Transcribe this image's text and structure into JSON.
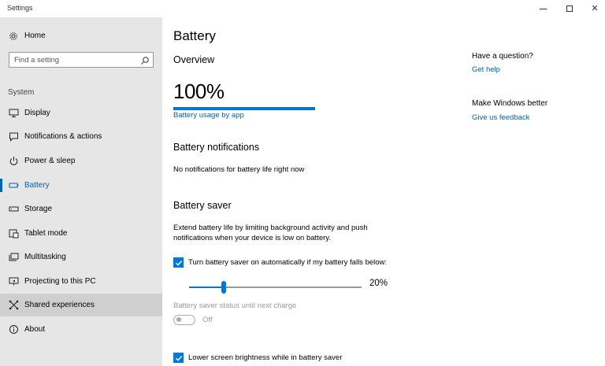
{
  "window": {
    "title": "Settings"
  },
  "sidebar": {
    "home_label": "Home",
    "search_placeholder": "Find a setting",
    "section_label": "System",
    "items": [
      {
        "label": "Display",
        "icon": "display-icon"
      },
      {
        "label": "Notifications & actions",
        "icon": "notifications-icon"
      },
      {
        "label": "Power & sleep",
        "icon": "power-icon"
      },
      {
        "label": "Battery",
        "icon": "battery-icon",
        "selected": true
      },
      {
        "label": "Storage",
        "icon": "storage-icon"
      },
      {
        "label": "Tablet mode",
        "icon": "tablet-mode-icon"
      },
      {
        "label": "Multitasking",
        "icon": "multitasking-icon"
      },
      {
        "label": "Projecting to this PC",
        "icon": "projecting-icon"
      },
      {
        "label": "Shared experiences",
        "icon": "shared-experiences-icon",
        "hover": true
      },
      {
        "label": "About",
        "icon": "about-icon"
      }
    ]
  },
  "main": {
    "page_title": "Battery",
    "overview": {
      "heading": "Overview",
      "percent_text": "100%",
      "charge_fraction": 1.0,
      "usage_link": "Battery usage by app"
    },
    "notifications": {
      "heading": "Battery notifications",
      "text": "No notifications for battery life right now"
    },
    "saver": {
      "heading": "Battery saver",
      "description": "Extend battery life by limiting background activity and push notifications when your device is low on battery.",
      "auto_checkbox_label": "Turn battery saver on automatically if my battery falls below:",
      "auto_checked": true,
      "threshold_value": 20,
      "threshold_text": "20%",
      "status_label": "Battery saver status until next charge",
      "status_toggle_text": "Off",
      "status_on": false,
      "brightness_checkbox_label": "Lower screen brightness while in battery saver",
      "brightness_checked": true
    }
  },
  "aside": {
    "question_heading": "Have a question?",
    "help_link": "Get help",
    "feedback_heading": "Make Windows better",
    "feedback_link": "Give us feedback"
  },
  "colors": {
    "accent": "#0078d7",
    "link": "#0063b1",
    "sidebar_bg": "#e6e6e6"
  }
}
